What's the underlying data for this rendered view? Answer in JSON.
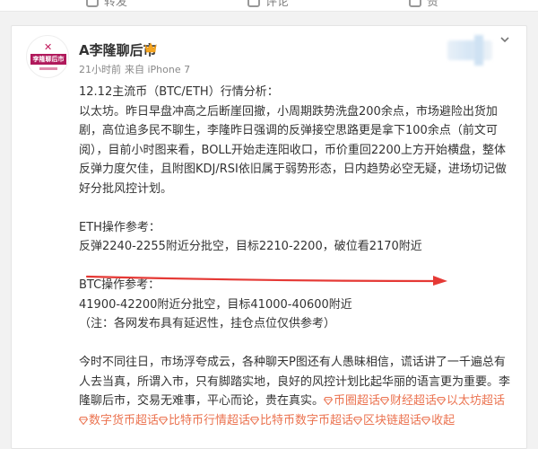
{
  "top_actions": {
    "share_label": "转发",
    "comment_label": "评论",
    "like_label": "赞"
  },
  "post": {
    "author": "A李隆聊后市",
    "avatar_text": "李隆聊后市",
    "time": "21小时前",
    "source": "来自 iPhone 7",
    "paragraphs": {
      "p1": "12.12主流币（BTC/ETH）行情分析：",
      "p2": "以太坊。昨日早盘冲高之后断崖回撤，小周期跌势洗盘200余点，市场避险出货加剧，高位追多民不聊生，李隆昨日强调的反弹接空思路更是拿下100余点（前文可阅），目前小时图来看，BOLL开始走连阳收口，币价重回2200上方开始横盘，整体反弹力度欠佳，且附图KDJ/RSI依旧属于弱势形态，日内趋势必空无疑，进场切记做好分批风控计划。",
      "eth_title": "ETH操作参考：",
      "eth_plan": "反弹2240-2255附近分批空，目标2210-2200，破位看2170附近",
      "btc_title": "BTC操作参考：",
      "btc_plan": "41900-42200附近分批空，目标41000-40600附近",
      "note": "（注：各网发布具有延迟性，挂仓点位仅供参考）",
      "closing": "今时不同往日，市场浮夸成云，各种聊天P图还有人愚昧相信，谎话讲了一千遍总有人去当真，所谓入市，只有脚踏实地，良好的风控计划比起华丽的语言更为重要。李隆聊后市，交易无难事，平心而论，贵在真实。"
    },
    "tags": [
      "币圈超话",
      "财经超话",
      "以太坊超话",
      "数字货币超话",
      "比特币行情超话",
      "比特币数字币超话",
      "区块链超话"
    ],
    "tag_tail": "收起"
  },
  "colors": {
    "tag": "#eb7350",
    "arrow": "#e53935"
  }
}
